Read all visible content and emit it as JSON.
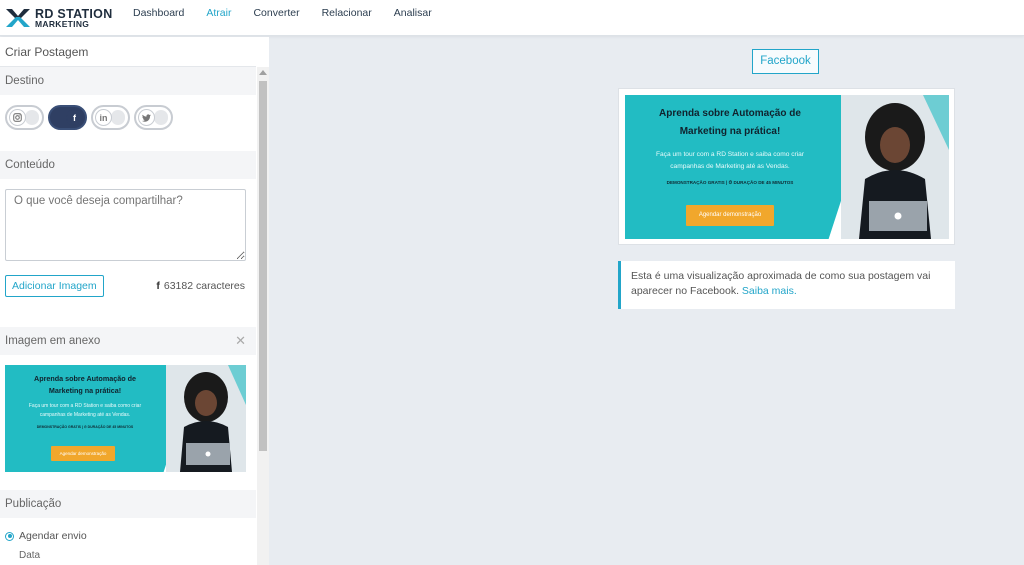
{
  "app": {
    "logo_line1": "RD STATION",
    "logo_line2": "MARKETING"
  },
  "nav": {
    "items": [
      "Dashboard",
      "Atrair",
      "Converter",
      "Relacionar",
      "Analisar"
    ],
    "active": "Atrair"
  },
  "left": {
    "title": "Criar Postagem",
    "destino_label": "Destino",
    "networks": [
      {
        "name": "instagram",
        "icon": "instagram-icon",
        "enabled": false
      },
      {
        "name": "facebook",
        "icon": "facebook-icon",
        "enabled": true
      },
      {
        "name": "linkedin",
        "icon": "linkedin-icon",
        "enabled": false
      },
      {
        "name": "twitter",
        "icon": "twitter-icon",
        "enabled": false
      }
    ],
    "conteudo_label": "Conteúdo",
    "content_placeholder": "O que você deseja compartilhar?",
    "add_image_label": "Adicionar Imagem",
    "char_count": "63182 caracteres",
    "anexo_label": "Imagem em anexo",
    "publicacao_label": "Publicação",
    "schedule_label": "Agendar envio",
    "data_label": "Data"
  },
  "banner": {
    "headline1": "Aprenda sobre Automação de",
    "headline2": "Marketing na prática!",
    "sub1": "Faça um tour com a RD Station e saiba como criar",
    "sub2": "campanhas de Marketing até as Vendas.",
    "tag": "DEMONSTRAÇÃO GRATIS | ⏱ DURAÇÃO DE 45 MINUTOS",
    "cta": "Agendar demonstração"
  },
  "preview": {
    "tab_label": "Facebook",
    "info_text": "Esta é uma visualização aproximada de como sua postagem vai aparecer no Facebook.",
    "info_link": "Saiba mais."
  },
  "colors": {
    "accent": "#22a5c9",
    "banner_teal": "#22bcc3",
    "cta_orange": "#f1a72c",
    "toggle_on": "#2f3f63"
  }
}
